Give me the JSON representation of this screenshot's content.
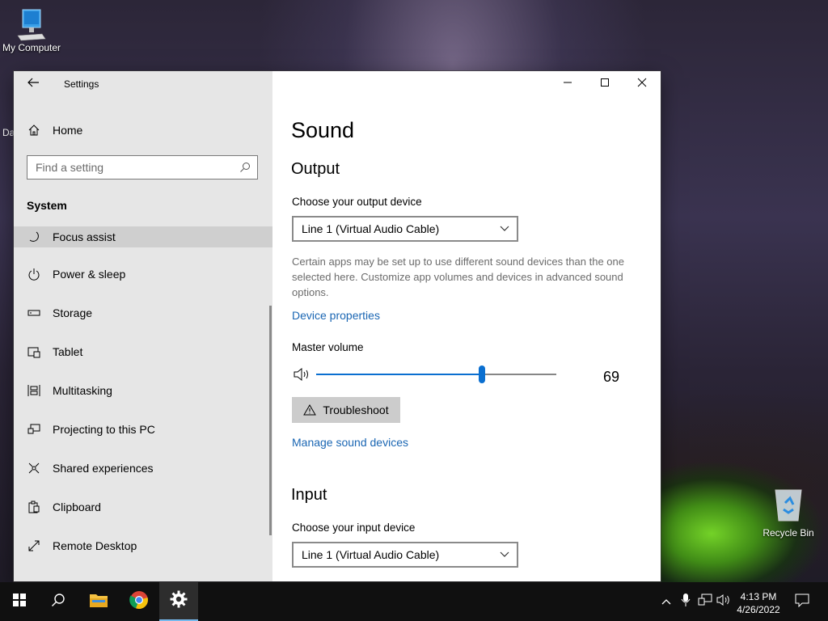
{
  "desktop": {
    "icons": [
      {
        "label": "My Computer",
        "icon": "computer-icon"
      },
      {
        "label": "Recycle Bin",
        "icon": "recycle-bin-icon"
      },
      {
        "label": "Da",
        "icon": "partial-icon"
      }
    ]
  },
  "window": {
    "title": "Settings",
    "controls": {
      "minimize": "minimize-icon",
      "maximize": "maximize-icon",
      "close": "close-icon"
    }
  },
  "sidebar": {
    "home_label": "Home",
    "search_placeholder": "Find a setting",
    "section_title": "System",
    "items": [
      {
        "label": "Focus assist",
        "icon": "moon-icon",
        "selected": true
      },
      {
        "label": "Power & sleep",
        "icon": "power-icon"
      },
      {
        "label": "Storage",
        "icon": "storage-icon"
      },
      {
        "label": "Tablet",
        "icon": "tablet-icon"
      },
      {
        "label": "Multitasking",
        "icon": "multitasking-icon"
      },
      {
        "label": "Projecting to this PC",
        "icon": "projecting-icon"
      },
      {
        "label": "Shared experiences",
        "icon": "shared-experiences-icon"
      },
      {
        "label": "Clipboard",
        "icon": "clipboard-icon"
      },
      {
        "label": "Remote Desktop",
        "icon": "remote-desktop-icon"
      }
    ]
  },
  "sound": {
    "page_title": "Sound",
    "output": {
      "heading": "Output",
      "device_label": "Choose your output device",
      "device_value": "Line 1 (Virtual Audio Cable)",
      "description": "Certain apps may be set up to use different sound devices than the one selected here. Customize app volumes and devices in advanced sound options.",
      "device_properties_link": "Device properties",
      "master_volume_label": "Master volume",
      "volume": 69,
      "volume_text": "69",
      "troubleshoot_label": "Troubleshoot",
      "manage_link": "Manage sound devices"
    },
    "input": {
      "heading": "Input",
      "device_label": "Choose your input device",
      "device_value": "Line 1 (Virtual Audio Cable)"
    }
  },
  "taskbar": {
    "time": "4:13 PM",
    "date": "4/26/2022",
    "accent": "#76b9ed"
  },
  "colors": {
    "accent": "#0a6fd0",
    "link": "#1a66b3",
    "sidebar_bg": "#e6e6e6"
  }
}
